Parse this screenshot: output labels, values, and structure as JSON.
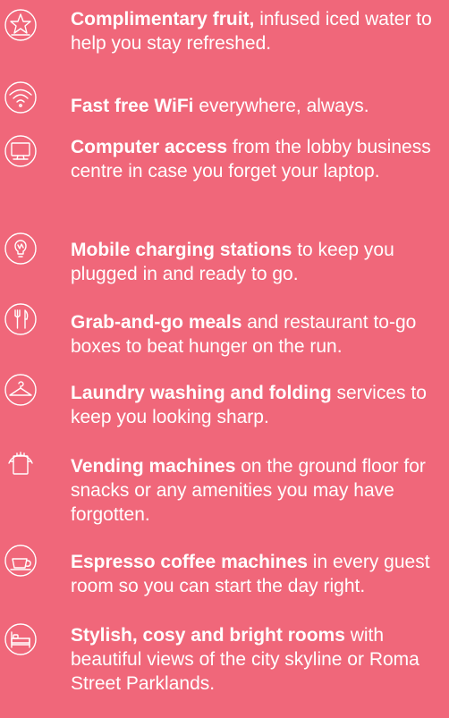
{
  "amenities": [
    {
      "icon": "star-plate-icon",
      "bold": "Complimentary fruit,",
      "rest": " infused iced water to help you stay refreshed."
    },
    {
      "icon": "wifi-icon",
      "bold": "Fast free WiFi",
      "rest": " everywhere, always."
    },
    {
      "icon": "computer-icon",
      "bold": "Computer access",
      "rest": " from the lobby business centre in case you forget your laptop."
    },
    {
      "icon": "lightbulb-icon",
      "bold": "Mobile charging stations",
      "rest": " to keep you plugged in and ready to go."
    },
    {
      "icon": "fork-knife-icon",
      "bold": "Grab-and-go meals",
      "rest": " and restaurant to-go boxes to beat hunger on the run."
    },
    {
      "icon": "hanger-icon",
      "bold": "Laundry washing and folding",
      "rest": " services to keep you looking sharp."
    },
    {
      "icon": "vending-machine-icon",
      "bold": "Vending machines",
      "rest": " on the ground floor for snacks or any amenities you may have forgotten."
    },
    {
      "icon": "coffee-cup-icon",
      "bold": "Espresso coffee machines",
      "rest": " in every guest room so you can start the day right."
    },
    {
      "icon": "bed-icon",
      "bold": "Stylish, cosy and bright rooms",
      "rest": " with beautiful views of the city skyline or Roma Street Parklands."
    }
  ],
  "colors": {
    "background": "#f0677a",
    "text": "#ffffff"
  }
}
